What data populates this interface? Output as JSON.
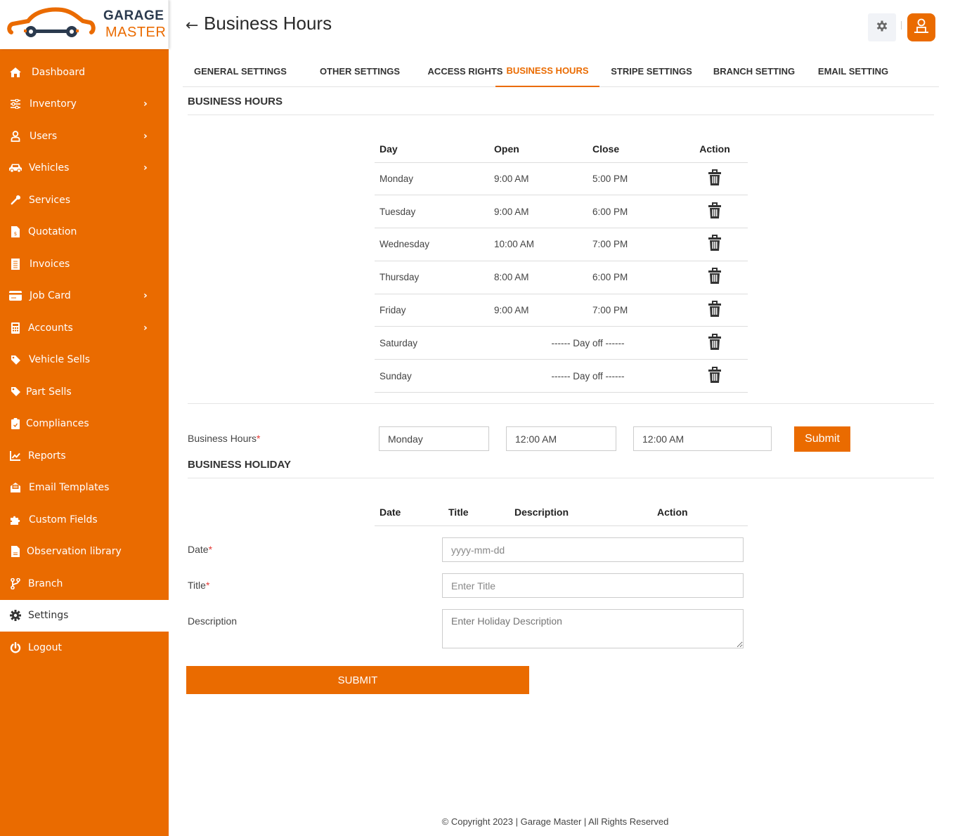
{
  "brand": {
    "line1": "GARAGE",
    "line2": "MASTER",
    "accent": "#ea6b00",
    "dark": "#2b3a4e"
  },
  "sidebar": {
    "items": [
      {
        "label": "Dashboard",
        "icon": "home-icon",
        "chevron": false,
        "active": false
      },
      {
        "label": "Inventory",
        "icon": "sliders-icon",
        "chevron": true,
        "active": false
      },
      {
        "label": "Users",
        "icon": "user-icon",
        "chevron": true,
        "active": false
      },
      {
        "label": "Vehicles",
        "icon": "car-icon",
        "chevron": true,
        "active": false
      },
      {
        "label": "Services",
        "icon": "wrench-icon",
        "chevron": false,
        "active": false
      },
      {
        "label": "Quotation",
        "icon": "file-invoice-dollar-icon",
        "chevron": false,
        "active": false
      },
      {
        "label": "Invoices",
        "icon": "receipt-icon",
        "chevron": false,
        "active": false
      },
      {
        "label": "Job Card",
        "icon": "credit-card-icon",
        "chevron": true,
        "active": false
      },
      {
        "label": "Accounts",
        "icon": "calculator-icon",
        "chevron": true,
        "active": false
      },
      {
        "label": "Vehicle Sells",
        "icon": "tag-icon",
        "chevron": false,
        "active": false
      },
      {
        "label": "Part Sells",
        "icon": "tag-icon",
        "chevron": false,
        "active": false
      },
      {
        "label": "Compliances",
        "icon": "clipboard-check-icon",
        "chevron": false,
        "active": false
      },
      {
        "label": "Reports",
        "icon": "chart-line-icon",
        "chevron": false,
        "active": false
      },
      {
        "label": "Email Templates",
        "icon": "envelope-open-icon",
        "chevron": false,
        "active": false
      },
      {
        "label": "Custom Fields",
        "icon": "puzzle-icon",
        "chevron": false,
        "active": false
      },
      {
        "label": "Observation library",
        "icon": "file-icon",
        "chevron": false,
        "active": false
      },
      {
        "label": "Branch",
        "icon": "code-branch-icon",
        "chevron": false,
        "active": false
      },
      {
        "label": "Settings",
        "icon": "gear-icon",
        "chevron": false,
        "active": true
      },
      {
        "label": "Logout",
        "icon": "power-icon",
        "chevron": false,
        "active": false
      }
    ]
  },
  "header": {
    "title": "Business Hours"
  },
  "tabs": [
    {
      "label": "GENERAL SETTINGS",
      "active": false
    },
    {
      "label": "OTHER SETTINGS",
      "active": false
    },
    {
      "label": "ACCESS RIGHTS",
      "active": false
    },
    {
      "label": "BUSINESS HOURS",
      "active": true
    },
    {
      "label": "STRIPE SETTINGS",
      "active": false
    },
    {
      "label": "BRANCH SETTING",
      "active": false
    },
    {
      "label": "EMAIL SETTING",
      "active": false
    }
  ],
  "business_hours": {
    "section_title": "BUSINESS HOURS",
    "columns": [
      "Day",
      "Open",
      "Close",
      "Action"
    ],
    "rows": [
      {
        "day": "Monday",
        "open": "9:00 AM",
        "close": "5:00 PM"
      },
      {
        "day": "Tuesday",
        "open": "9:00 AM",
        "close": "6:00 PM"
      },
      {
        "day": "Wednesday",
        "open": "10:00 AM",
        "close": "7:00 PM"
      },
      {
        "day": "Thursday",
        "open": "8:00 AM",
        "close": "6:00 PM"
      },
      {
        "day": "Friday",
        "open": "9:00 AM",
        "close": "7:00 PM"
      },
      {
        "day": "Saturday",
        "off": "------ Day off ------"
      },
      {
        "day": "Sunday",
        "off": "------ Day off ------"
      }
    ],
    "form": {
      "label": "Business Hours",
      "required_mark": "*",
      "day_value": "Monday",
      "open_value": "12:00 AM",
      "close_value": "12:00 AM",
      "submit_label": "Submit"
    }
  },
  "business_holiday": {
    "section_title": "BUSINESS HOLIDAY",
    "columns": [
      "Date",
      "Title",
      "Description",
      "Action"
    ],
    "form": {
      "date_label": "Date",
      "date_placeholder": "yyyy-mm-dd",
      "title_label": "Title",
      "title_placeholder": "Enter Title",
      "description_label": "Description",
      "description_placeholder": "Enter Holiday Description",
      "required_mark": "*",
      "submit_label": "SUBMIT"
    }
  },
  "footer": {
    "text": "© Copyright 2023 | Garage Master | All Rights Reserved"
  }
}
